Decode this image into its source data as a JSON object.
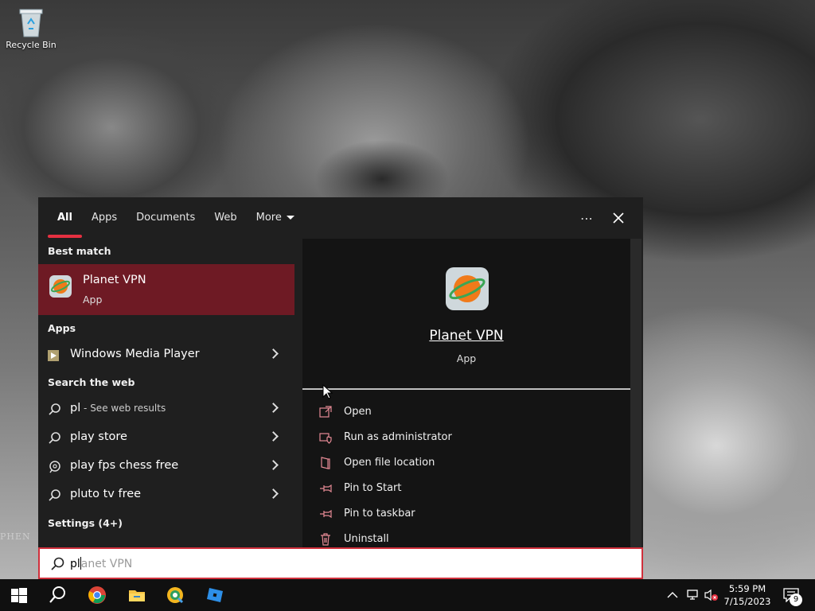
{
  "desktop": {
    "recycle_bin_label": "Recycle Bin",
    "edge_text": "PHEN"
  },
  "tabs": [
    {
      "label": "All"
    },
    {
      "label": "Apps"
    },
    {
      "label": "Documents"
    },
    {
      "label": "Web"
    },
    {
      "label": "More"
    }
  ],
  "left": {
    "best_match_title": "Best match",
    "best_match": {
      "name": "Planet VPN",
      "type": "App"
    },
    "apps_title": "Apps",
    "apps": [
      {
        "label": "Windows Media Player"
      }
    ],
    "web_title": "Search the web",
    "web": [
      {
        "label": "pl",
        "sub": " - See web results"
      },
      {
        "label": "play store"
      },
      {
        "label": "play fps chess free"
      },
      {
        "label": "pluto tv free"
      }
    ],
    "settings_title": "Settings (4+)"
  },
  "detail": {
    "name": "Planet VPN",
    "type": "App",
    "actions": [
      {
        "label": "Open",
        "icon": "open-icon"
      },
      {
        "label": "Run as administrator",
        "icon": "shield-icon"
      },
      {
        "label": "Open file location",
        "icon": "file-location-icon"
      },
      {
        "label": "Pin to Start",
        "icon": "pin-icon"
      },
      {
        "label": "Pin to taskbar",
        "icon": "pin-icon"
      },
      {
        "label": "Uninstall",
        "icon": "trash-icon"
      }
    ]
  },
  "search": {
    "typed": "pl",
    "suggestion": "anet VPN"
  },
  "taskbar": {
    "time": "5:59 PM",
    "date": "7/15/2023",
    "notifications": "9"
  },
  "colors": {
    "accent": "#e53040",
    "selected_row": "#6e1a24",
    "panel": "#1f1f1f"
  }
}
